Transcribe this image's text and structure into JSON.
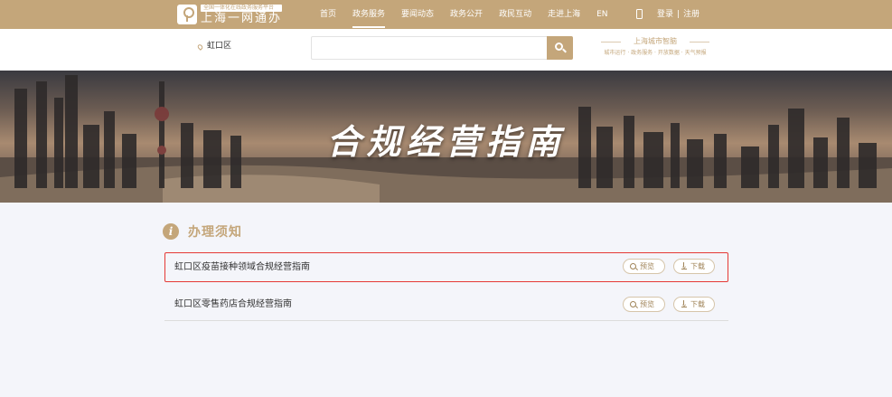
{
  "header": {
    "logo_subtitle": "全国一体化在线政务服务平台",
    "logo_title": "上海一网通办",
    "nav": [
      {
        "label": "首页",
        "active": false
      },
      {
        "label": "政务服务",
        "active": true
      },
      {
        "label": "要闻动态",
        "active": false
      },
      {
        "label": "政务公开",
        "active": false
      },
      {
        "label": "政民互动",
        "active": false
      },
      {
        "label": "走进上海",
        "active": false
      },
      {
        "label": "EN",
        "active": false
      }
    ],
    "login_label": "登录",
    "register_label": "注册",
    "divider": "|"
  },
  "search": {
    "location": "虹口区",
    "placeholder": "",
    "value": ""
  },
  "brand_card": {
    "title": "上海城市智脑",
    "tags": "城市运行 · 政务服务 · 开放数据 · 天气预报"
  },
  "banner": {
    "title": "合规经营指南"
  },
  "notice": {
    "icon_glyph": "i",
    "title": "办理须知",
    "items": [
      {
        "name": "虹口区疫苗接种领域合规经营指南",
        "preview_label": "预览",
        "download_label": "下载"
      },
      {
        "name": "虹口区零售药店合规经营指南",
        "preview_label": "预览",
        "download_label": "下载"
      }
    ]
  },
  "colors": {
    "accent": "#c4a67a",
    "highlight": "#e53935",
    "background": "#f4f5fa"
  }
}
